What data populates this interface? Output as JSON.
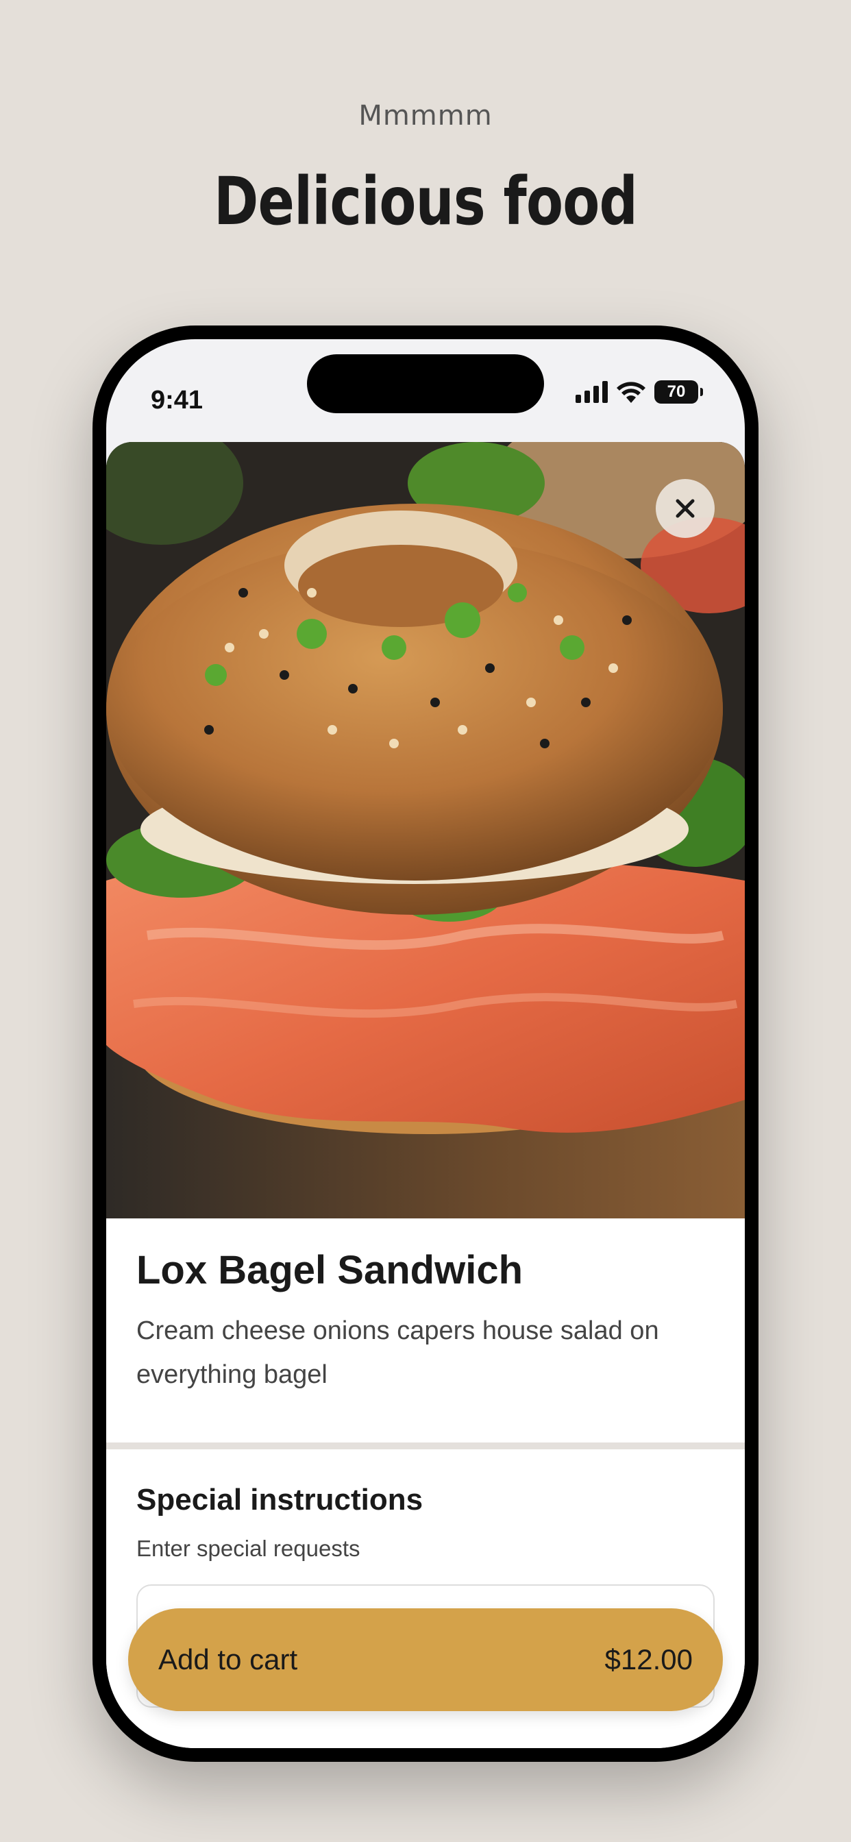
{
  "header": {
    "eyebrow": "Mmmmm",
    "headline": "Delicious food"
  },
  "status_bar": {
    "time": "9:41",
    "battery": "70",
    "icons": [
      "signal-icon",
      "wifi-icon",
      "battery-icon"
    ]
  },
  "product": {
    "image_icon": "bagel-photo",
    "close_icon": "close-icon",
    "title": "Lox Bagel Sandwich",
    "description": "Cream cheese onions capers house salad on everything bagel"
  },
  "special_instructions": {
    "title": "Special instructions",
    "subtitle": "Enter special requests",
    "value": "",
    "placeholder": ""
  },
  "cart_button": {
    "label": "Add to cart",
    "price": "$12.00",
    "color": "#d4a24a"
  },
  "colors": {
    "background": "#e4dfd9",
    "accent": "#d4a24a"
  }
}
